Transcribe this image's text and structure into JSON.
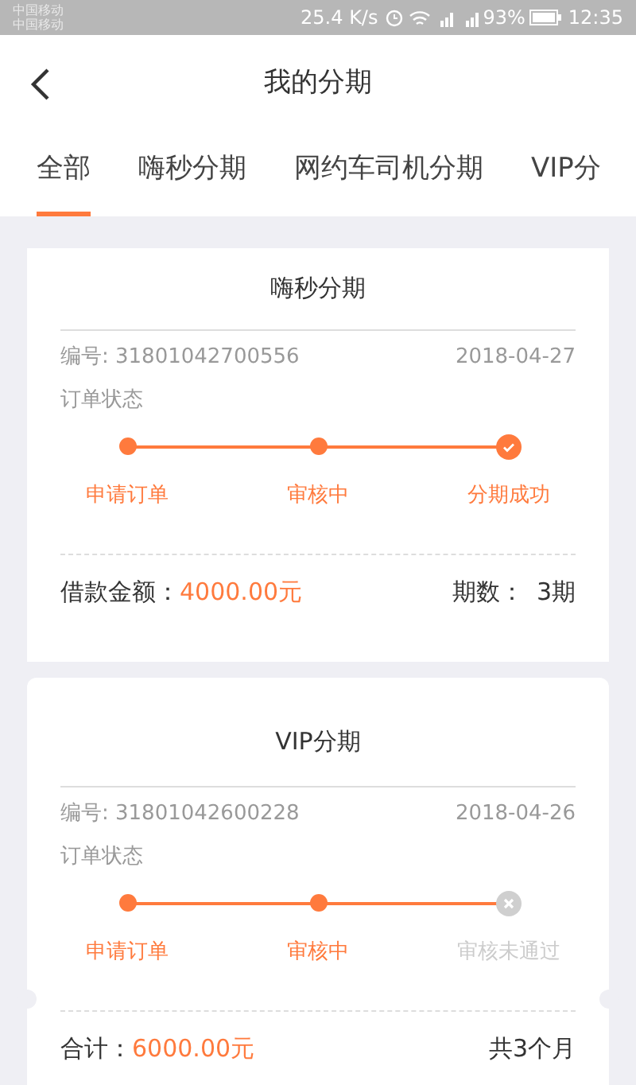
{
  "status_bar": {
    "carriers": [
      "中国移动",
      "中国移动"
    ],
    "speed": "25.4 K/s",
    "battery_percent": "93%",
    "time": "12:35"
  },
  "header": {
    "title": "我的分期"
  },
  "tabs": [
    {
      "label": "全部",
      "selected": true
    },
    {
      "label": "嗨秒分期",
      "selected": false
    },
    {
      "label": "网约车司机分期",
      "selected": false
    },
    {
      "label": "VIP分",
      "selected": false
    }
  ],
  "orders": [
    {
      "title": "嗨秒分期",
      "number": "编号: 31801042700556",
      "date": "2018-04-27",
      "status_label": "订单状态",
      "steps": [
        {
          "label": "申请订单",
          "kind": "done"
        },
        {
          "label": "审核中",
          "kind": "done"
        },
        {
          "label": "分期成功",
          "kind": "success"
        }
      ],
      "footer": {
        "left_label": "借款金额：",
        "amount": "4000.00元",
        "right_label": "期数：",
        "right_value": "3期"
      },
      "notched": false
    },
    {
      "title": "VIP分期",
      "number": "编号: 31801042600228",
      "date": "2018-04-26",
      "status_label": "订单状态",
      "steps": [
        {
          "label": "申请订单",
          "kind": "done"
        },
        {
          "label": "审核中",
          "kind": "done"
        },
        {
          "label": "审核未通过",
          "kind": "failed"
        }
      ],
      "footer": {
        "left_label": "合计：",
        "amount": "6000.00元",
        "right_value": "共3个月"
      },
      "notched": true
    }
  ]
}
